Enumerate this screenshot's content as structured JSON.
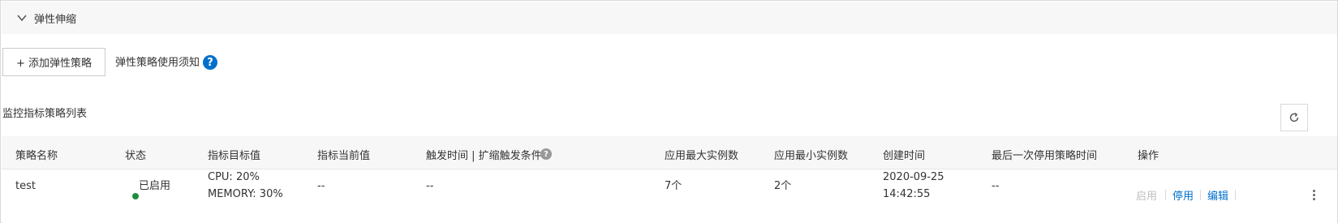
{
  "section": {
    "title": "弹性伸缩"
  },
  "toolbar": {
    "add_button": "+ 添加弹性策略",
    "notice_link": "弹性策略使用须知",
    "help_glyph": "?"
  },
  "list": {
    "title": "监控指标策略列表",
    "columns": [
      "策略名称",
      "状态",
      "指标目标值",
      "指标当前值",
      "触发时间 | 扩缩触发条件",
      "应用最大实例数",
      "应用最小实例数",
      "创建时间",
      "最后一次停用策略时间",
      "操作"
    ],
    "help_glyph": "?",
    "rows": [
      {
        "name": "test",
        "status": "已启用",
        "target_line1": "CPU: 20%",
        "target_line2": "MEMORY: 30%",
        "current": "--",
        "trigger": "--",
        "max_instances": "7个",
        "min_instances": "2个",
        "created_date": "2020-09-25",
        "created_time": "14:42:55",
        "last_disabled": "--",
        "actions": {
          "enable": "启用",
          "disable": "停用",
          "edit": "编辑"
        }
      }
    ]
  },
  "colors": {
    "header_bg": "#f7f7f7",
    "link_blue": "#0070cc",
    "status_green": "#1e8e3e",
    "disabled_gray": "#bfbfbf"
  },
  "icons": [
    "chevron-down-icon",
    "help-icon",
    "refresh-icon",
    "more-vertical-icon",
    "status-dot-icon"
  ]
}
